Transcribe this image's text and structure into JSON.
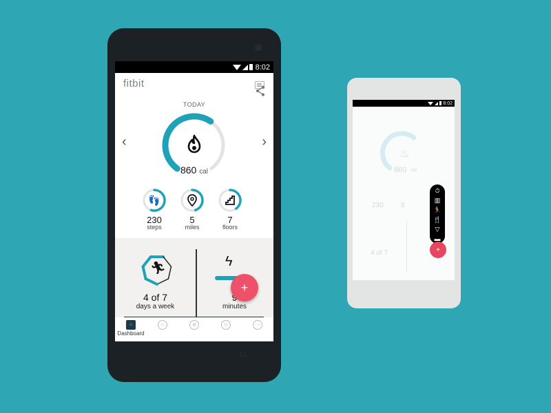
{
  "status_bar": {
    "time": "8:02"
  },
  "app": {
    "logo": "fitbit",
    "date_label": "TODAY",
    "nav_prev": "‹",
    "nav_next": "›",
    "calories": {
      "value": "860",
      "unit": "cal",
      "progress": 0.62
    },
    "stats": [
      {
        "icon": "footsteps-icon",
        "glyph": "👣",
        "value": "230",
        "unit": "steps",
        "progress": 0.55
      },
      {
        "icon": "location-pin-icon",
        "glyph": "⌾",
        "value": "5",
        "unit": "miles",
        "progress": 0.45
      },
      {
        "icon": "stairs-icon",
        "glyph": "⌐",
        "value": "7",
        "unit": "floors",
        "progress": 0.4
      }
    ],
    "exercise": {
      "value": "4 of 7",
      "label": "days a week",
      "progress": 0.571
    },
    "active_minutes": {
      "value": "9",
      "label": "minutes"
    },
    "fab_label": "+",
    "bottom_nav": [
      {
        "name": "dashboard",
        "label": "Dashboard",
        "glyph": "⁘",
        "active": true
      },
      {
        "name": "challenges",
        "label": "",
        "glyph": "☆",
        "active": false
      },
      {
        "name": "guidance",
        "label": "",
        "glyph": "⊘",
        "active": false
      },
      {
        "name": "friends",
        "label": "",
        "glyph": "⚇",
        "active": false
      },
      {
        "name": "more",
        "label": "",
        "glyph": "⋯",
        "active": false
      }
    ]
  },
  "secondary_phone": {
    "time": "8:02",
    "calories_value": "860",
    "calories_unit": "cal",
    "stats": [
      "230",
      "5"
    ],
    "exercise_value": "4 of 7",
    "speed_dial": [
      {
        "icon": "stopwatch-icon",
        "glyph": "⏱"
      },
      {
        "icon": "barcode-icon",
        "glyph": "▥"
      },
      {
        "icon": "exercise-icon",
        "glyph": "🏃"
      },
      {
        "icon": "food-icon",
        "glyph": "🍴"
      },
      {
        "icon": "water-icon",
        "glyph": "▽"
      },
      {
        "icon": "weight-icon",
        "glyph": "▬"
      }
    ],
    "fab_label": "+"
  },
  "colors": {
    "background": "#2fa6b4",
    "accent": "#1fa2b8",
    "fab": "#f0516a",
    "ring_track": "#e3e3e3"
  }
}
